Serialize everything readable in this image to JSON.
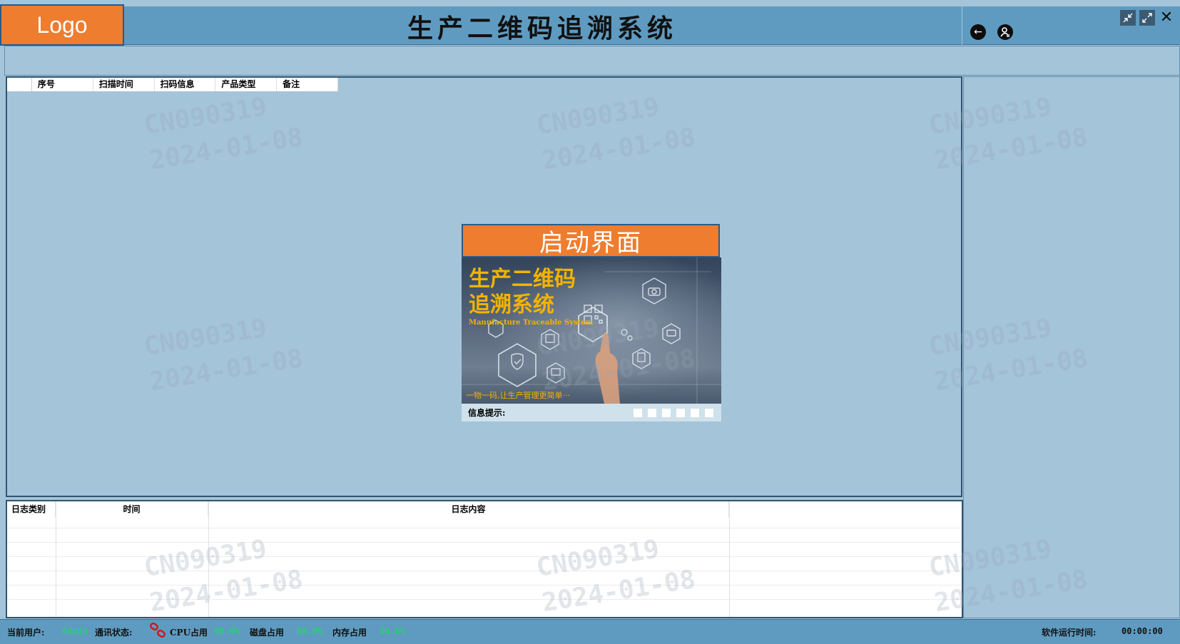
{
  "header": {
    "logo": "Logo",
    "title": "生产二维码追溯系统",
    "back_icon": "back-arrow-icon",
    "user_switch_icon": "user-switch-icon",
    "window_buttons": [
      "minimize-icon",
      "maximize-icon",
      "close-icon"
    ]
  },
  "scan_table": {
    "columns": [
      "序号",
      "扫描时间",
      "扫码信息",
      "产品类型",
      "备注"
    ]
  },
  "splash": {
    "title": "启动界面",
    "image": {
      "headline_line1": "生产二维码",
      "headline_line2": "追溯系统",
      "subtitle": "Manufacture Traceable System",
      "slogan": "一物一码,让生产管理更简单···",
      "icons": [
        "camera-icon",
        "qr-code-icon",
        "shield-check-icon",
        "gear-icon",
        "chat-icon",
        "document-icon",
        "gift-icon",
        "building-icon"
      ]
    },
    "status_label": "信息提示:",
    "progress_squares": 6
  },
  "log_table": {
    "columns": [
      "日志类别",
      "时间",
      "日志内容",
      ""
    ]
  },
  "statusbar": {
    "current_user_label": "当前用户:",
    "current_user": "Admin",
    "comm_status_label": "通讯状态:",
    "comm_icon": "link-broken-icon",
    "cpu_label": "CPU占用",
    "cpu_value": "00.0%",
    "disk_label": "磁盘占用",
    "disk_value": "00.0%",
    "mem_label": "内存占用",
    "mem_value": "00.0%",
    "runtime_label": "软件运行时间:",
    "runtime_value": "00:00:00"
  },
  "watermark": {
    "line1": "CN090319",
    "line2": "2024-01-08"
  },
  "colors": {
    "titlebar": "#5f9bc0",
    "background": "#a4c4da",
    "accent_orange": "#ee7d2f",
    "status_green": "#19e05a"
  }
}
